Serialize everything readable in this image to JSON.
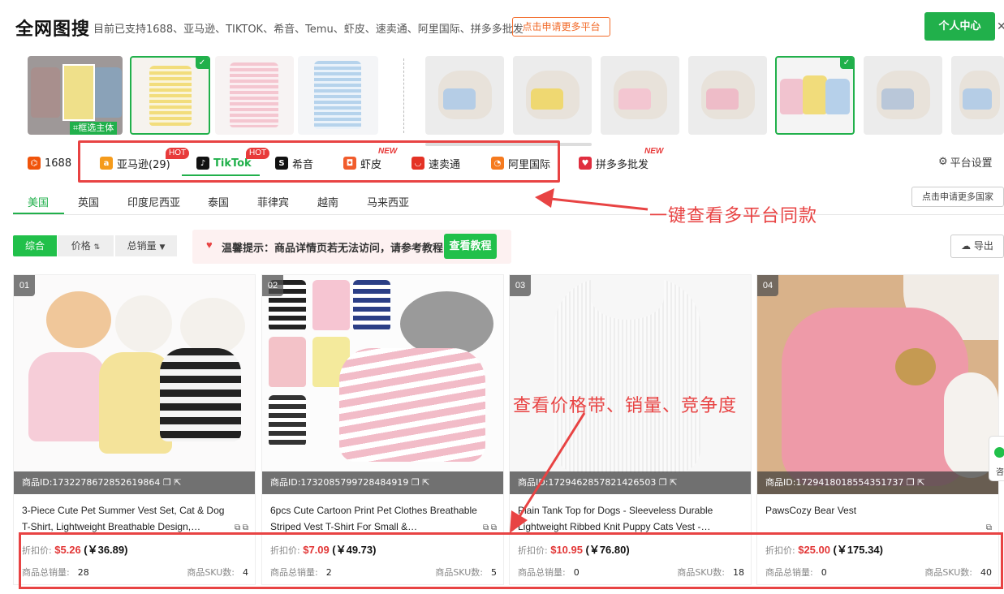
{
  "header": {
    "logo": "全网图搜",
    "support_text": "目前已支持1688、亚马逊、TIKTOK、希音、Temu、虾皮、速卖通、阿里国际、拼多多批发",
    "apply_button": "点击申请更多平台",
    "user_button": "个人中心",
    "close": "✕"
  },
  "thumbnails": {
    "crop_label": "框选主体",
    "selected_check": "✓"
  },
  "platforms": [
    {
      "label": "1688",
      "icon": "1688-icon",
      "color": "#f0540b"
    },
    {
      "label": "亚马逊(29)",
      "icon": "amazon-icon",
      "color": "#f59b1c",
      "badge": "HOT"
    },
    {
      "label": "TikTok",
      "icon": "tiktok-icon",
      "color": "#111111",
      "badge": "HOT",
      "active": true
    },
    {
      "label": "希音",
      "icon": "shein-icon",
      "color": "#111111"
    },
    {
      "label": "虾皮",
      "icon": "shopee-icon",
      "color": "#f15c2c",
      "badge": "NEW"
    },
    {
      "label": "速卖通",
      "icon": "aliexpress-icon",
      "color": "#e43225"
    },
    {
      "label": "阿里国际",
      "icon": "alibaba-icon",
      "color": "#f57a1f"
    },
    {
      "label": "拼多多批发",
      "icon": "pdd-icon",
      "color": "#e02e3f",
      "badge": "NEW"
    }
  ],
  "platform_settings": "平台设置",
  "countries": [
    "美国",
    "英国",
    "印度尼西亚",
    "泰国",
    "菲律宾",
    "越南",
    "马来西亚"
  ],
  "more_countries": "点击申请更多国家",
  "annotations": {
    "multi_platform": "一键查看多平台同款",
    "price_band": "查看价格带、销量、竞争度"
  },
  "sort": {
    "all": "综合",
    "price": "价格",
    "sales": "总销量"
  },
  "tip": {
    "text": "温馨提示：商品详情页若无法访问，请参考教程",
    "button": "查看教程"
  },
  "export": "导出",
  "labels": {
    "discount_price": "折扣价:",
    "total_sales": "商品总销量:",
    "sku_count": "商品SKU数:"
  },
  "products": [
    {
      "num": "01",
      "id": "商品ID:1732278672852619864",
      "title": "3-Piece Cute Pet Summer Vest Set, Cat & Dog T-Shirt, Lightweight Breathable Design,…",
      "price_usd": "$5.26",
      "price_cny": "(￥36.89)",
      "sales": "28",
      "sku": "4"
    },
    {
      "num": "02",
      "id": "商品ID:1732085799728484919",
      "title": "6pcs Cute Cartoon Print Pet Clothes Breathable Striped Vest T-Shirt For Small &…",
      "price_usd": "$7.09",
      "price_cny": "(￥49.73)",
      "sales": "2",
      "sku": "5"
    },
    {
      "num": "03",
      "id": "商品ID:1729462857821426503",
      "title": "Plain Tank Top for Dogs - Sleeveless Durable Lightweight Ribbed Knit Puppy Cats Vest -…",
      "price_usd": "$10.95",
      "price_cny": "(￥76.80)",
      "sales": "0",
      "sku": "18"
    },
    {
      "num": "04",
      "id": "商品ID:1729418018554351737",
      "title": "PawsCozy Bear Vest",
      "price_usd": "$25.00",
      "price_cny": "(￥175.34)",
      "sales": "0",
      "sku": "40"
    }
  ],
  "side_float": "咨"
}
